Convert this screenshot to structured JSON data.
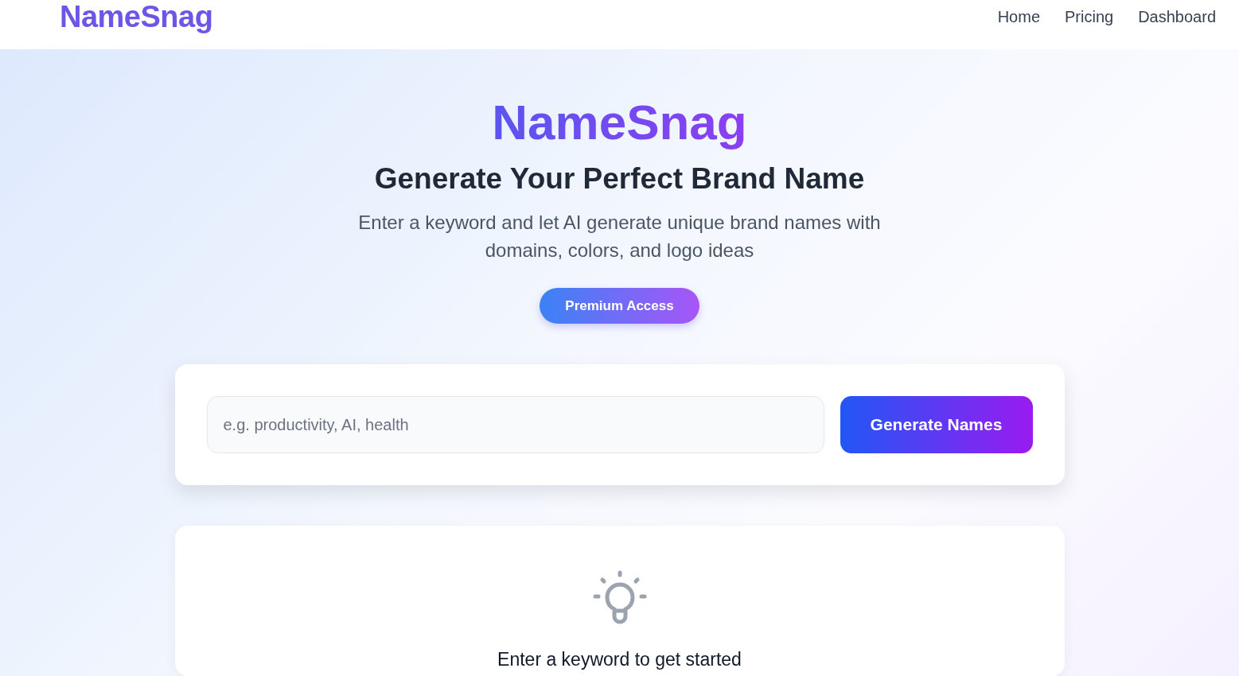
{
  "header": {
    "logo": "NameSnag",
    "nav": [
      {
        "label": "Home"
      },
      {
        "label": "Pricing"
      },
      {
        "label": "Dashboard"
      }
    ]
  },
  "hero": {
    "title": "NameSnag",
    "subtitle": "Generate Your Perfect Brand Name",
    "description": "Enter a keyword and let AI generate unique brand names with domains, colors, and logo ideas",
    "premium_button": "Premium Access"
  },
  "search": {
    "placeholder": "e.g. productivity, AI, health",
    "button": "Generate Names"
  },
  "empty_state": {
    "message": "Enter a keyword to get started"
  }
}
